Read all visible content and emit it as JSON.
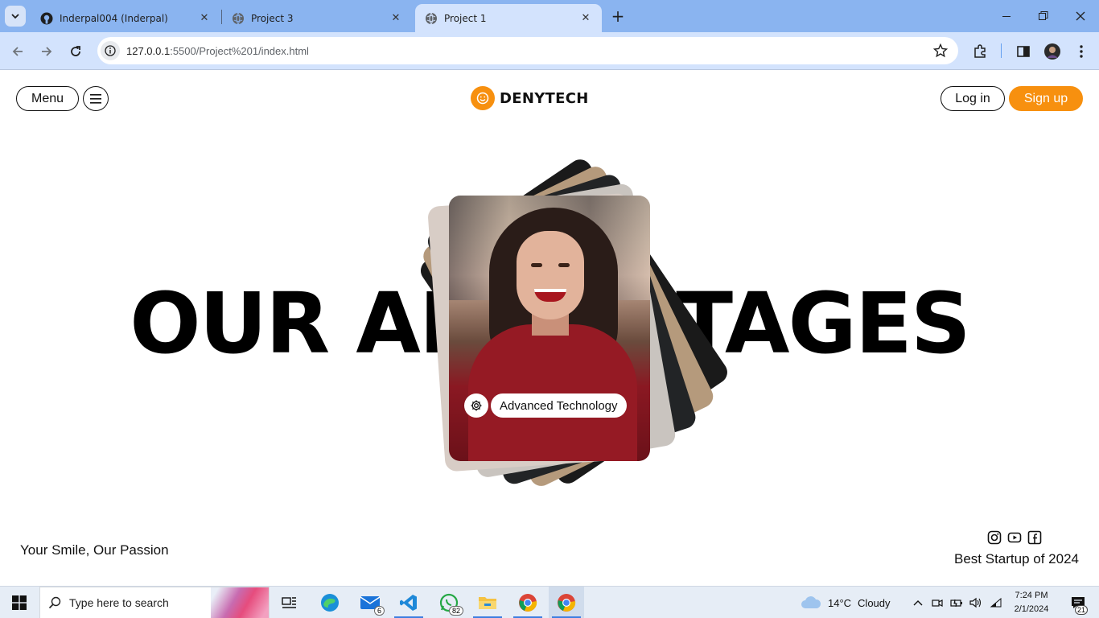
{
  "browser": {
    "tabs": [
      {
        "title": "Inderpal004 (Inderpal)",
        "icon": "github-icon",
        "active": false
      },
      {
        "title": "Project 3",
        "icon": "globe-icon",
        "active": false
      },
      {
        "title": "Project 1",
        "icon": "globe-icon",
        "active": true
      }
    ],
    "address": {
      "host": "127.0.0.1",
      "path": ":5500/Project%201/index.html"
    }
  },
  "site": {
    "menu_label": "Menu",
    "brand_name": "DENYTECH",
    "login_label": "Log in",
    "signup_label": "Sign up",
    "headline": "OUR ADVANTAGES",
    "feature_badge": "Advanced Technology",
    "tagline": "Your Smile, Our Passion",
    "award": "Best Startup of 2024",
    "socials": [
      "instagram-icon",
      "youtube-icon",
      "facebook-icon"
    ],
    "accent_color": "#f7900f"
  },
  "taskbar": {
    "search_placeholder": "Type here to search",
    "apps": [
      {
        "name": "task-view",
        "badge": ""
      },
      {
        "name": "edge",
        "badge": ""
      },
      {
        "name": "mail",
        "badge": "6"
      },
      {
        "name": "vscode",
        "badge": ""
      },
      {
        "name": "whatsapp",
        "badge": "82"
      },
      {
        "name": "file-explorer",
        "badge": ""
      },
      {
        "name": "chrome",
        "badge": ""
      },
      {
        "name": "chrome",
        "badge": ""
      }
    ],
    "weather": {
      "temp": "14°C",
      "condition": "Cloudy"
    },
    "time": "7:24 PM",
    "date": "2/1/2024",
    "notifications": "21"
  }
}
